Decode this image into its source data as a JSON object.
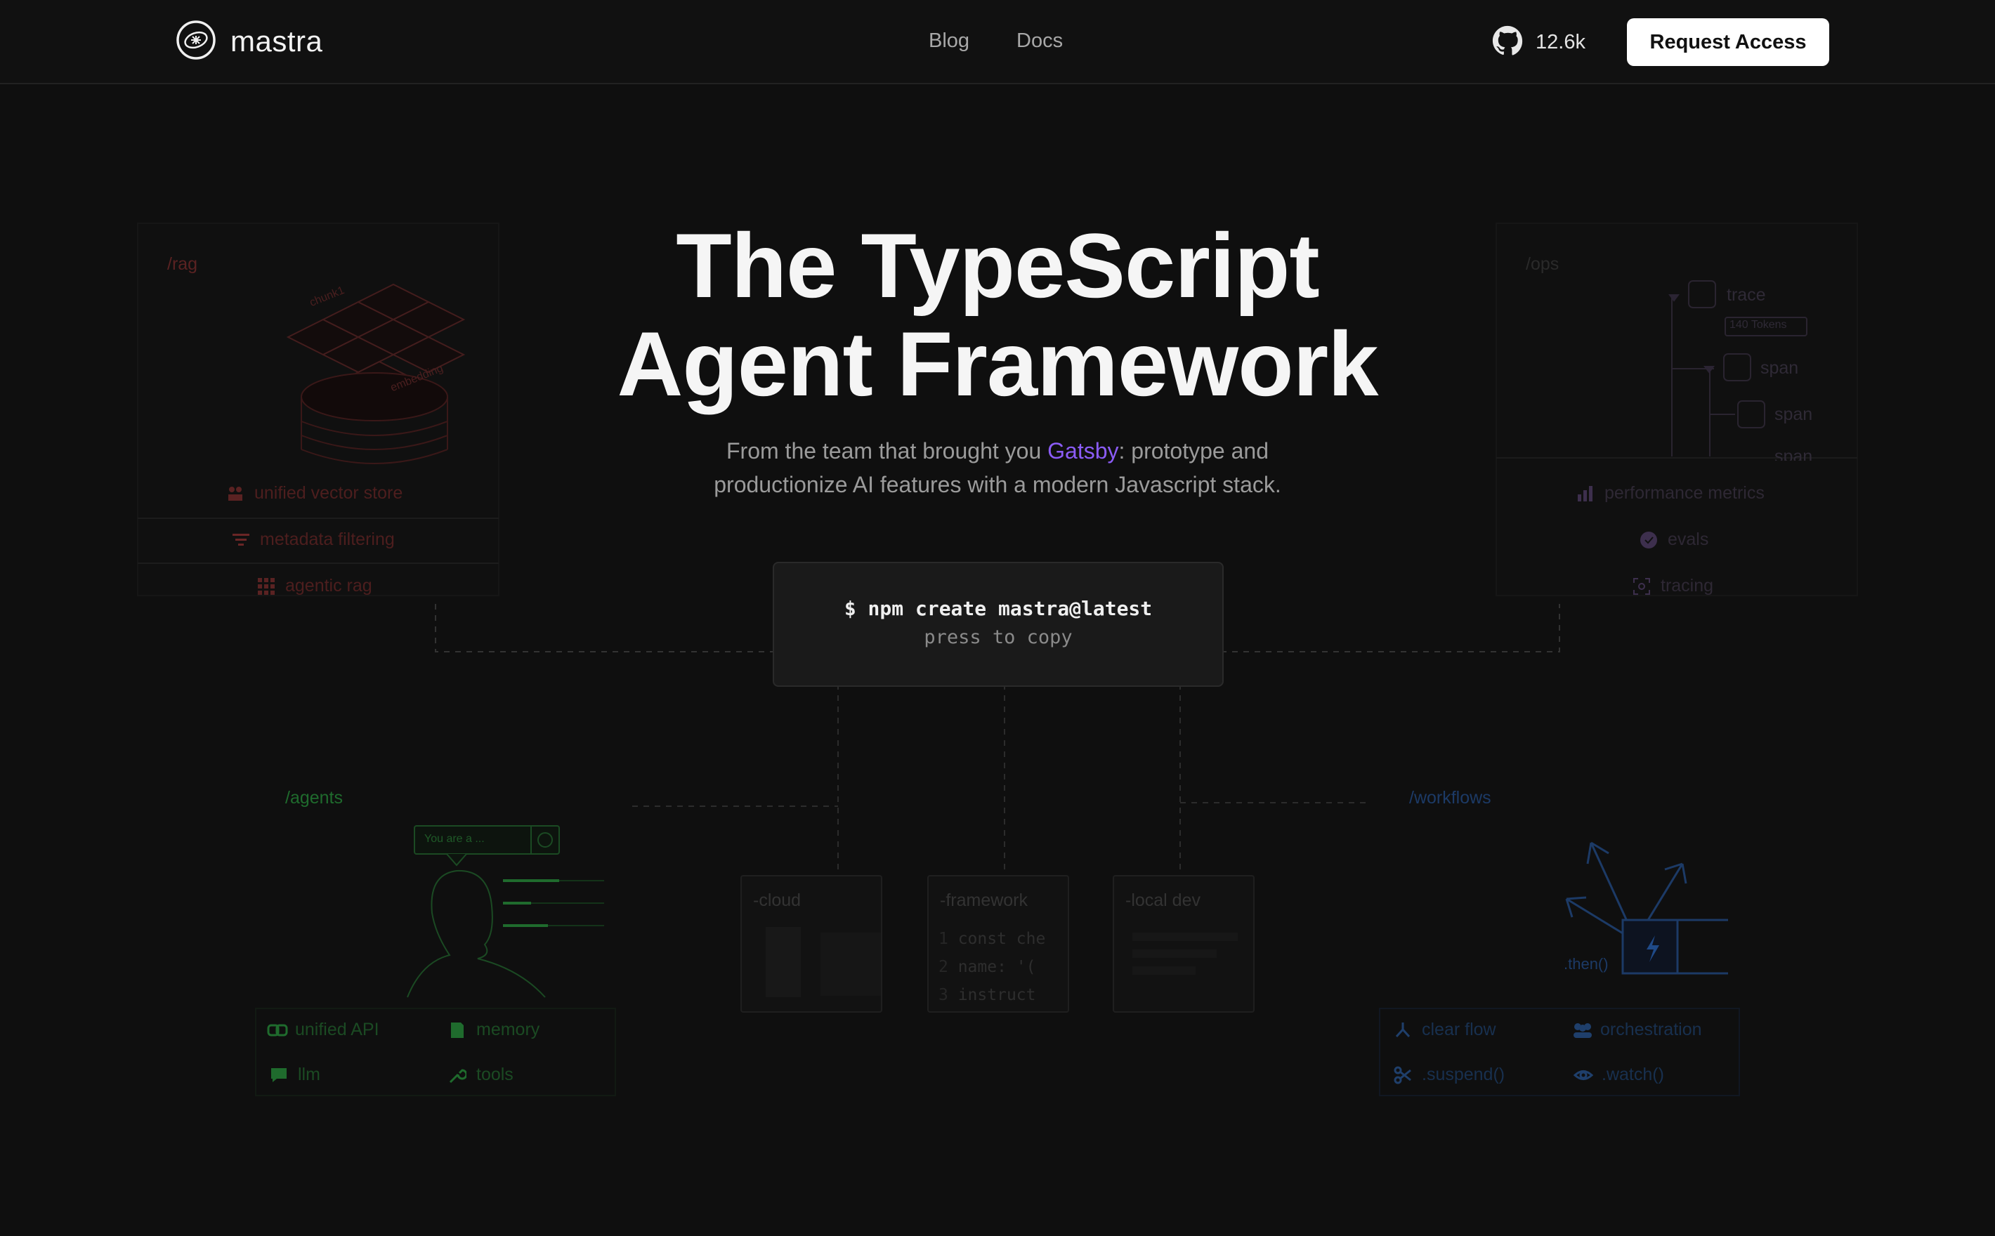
{
  "header": {
    "logo_text": "mastra",
    "nav": [
      {
        "label": "Blog"
      },
      {
        "label": "Docs"
      }
    ],
    "github": {
      "stars": "12.6k",
      "icon": "github-icon"
    },
    "cta_label": "Request Access"
  },
  "hero": {
    "title_line1": "The TypeScript",
    "title_line2": "Agent Framework",
    "subtitle_pre": "From the team that brought you ",
    "subtitle_link": "Gatsby",
    "subtitle_post_line1": ": prototype and",
    "subtitle_line2": "productionize AI features with a modern Javascript stack."
  },
  "command": {
    "text": "$ npm create mastra@latest",
    "hint": "press to copy"
  },
  "rag": {
    "label": "/rag",
    "diagram_tags": [
      "chunk1",
      "embedding"
    ],
    "features": [
      {
        "label": "unified vector store",
        "icon": "vector-store-icon"
      },
      {
        "label": "metadata filtering",
        "icon": "filter-icon"
      },
      {
        "label": "agentic rag",
        "icon": "grid-icon"
      }
    ],
    "color": "#7a2a2a"
  },
  "ops": {
    "label": "/ops",
    "tree": [
      {
        "label": "trace"
      },
      {
        "label": "140 Tokens"
      },
      {
        "label": "span"
      },
      {
        "label": "span"
      },
      {
        "label": "span"
      }
    ],
    "features": [
      {
        "label": "performance metrics",
        "icon": "bar-chart-icon"
      },
      {
        "label": "evals",
        "icon": "evals-icon"
      },
      {
        "label": "tracing",
        "icon": "tracing-icon"
      }
    ],
    "color": "#5a3a7a"
  },
  "agents": {
    "label": "/agents",
    "prompt_placeholder": "You are a ...",
    "features": [
      {
        "label": "unified API",
        "icon": "link-icon"
      },
      {
        "label": "memory",
        "icon": "book-icon"
      },
      {
        "label": "llm",
        "icon": "chat-icon"
      },
      {
        "label": "tools",
        "icon": "wrench-icon"
      }
    ],
    "color": "#1f6b2d"
  },
  "workflows": {
    "label": "/workflows",
    "then_label": ".then()",
    "features": [
      {
        "label": "clear flow",
        "icon": "flow-icon"
      },
      {
        "label": "orchestration",
        "icon": "users-icon"
      },
      {
        "label": ".suspend()",
        "icon": "scissors-icon"
      },
      {
        "label": ".watch()",
        "icon": "eye-icon"
      }
    ],
    "color": "#1f3f6b"
  },
  "cards": [
    {
      "label": "-cloud"
    },
    {
      "label": "-framework",
      "code": [
        "const che",
        "name: '(",
        "instruct"
      ]
    },
    {
      "label": "-local dev"
    }
  ]
}
